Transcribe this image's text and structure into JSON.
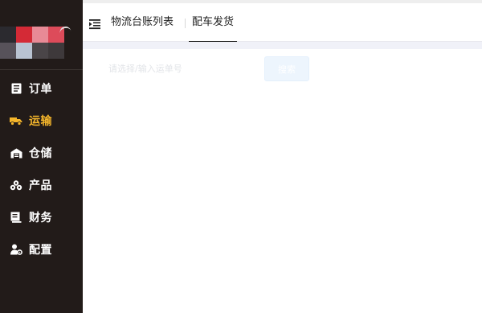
{
  "sidebar": {
    "items": [
      {
        "label": "订单",
        "icon": "document-list-icon",
        "active": false
      },
      {
        "label": "运输",
        "icon": "truck-icon",
        "active": true
      },
      {
        "label": "仓储",
        "icon": "warehouse-icon",
        "active": false
      },
      {
        "label": "产品",
        "icon": "boxes-icon",
        "active": false
      },
      {
        "label": "财务",
        "icon": "ledger-icon",
        "active": false
      },
      {
        "label": "配置",
        "icon": "user-settings-icon",
        "active": false
      }
    ]
  },
  "tabs": [
    {
      "label": "物流台账列表",
      "active": false
    },
    {
      "label": "配车发货",
      "active": true
    }
  ],
  "search": {
    "placeholder": "请选择/输入运单号",
    "button_label": "搜索"
  },
  "colors": {
    "sidebar_bg": "#221b19",
    "accent": "#f5b62b",
    "button_bg": "#edf5fd"
  }
}
